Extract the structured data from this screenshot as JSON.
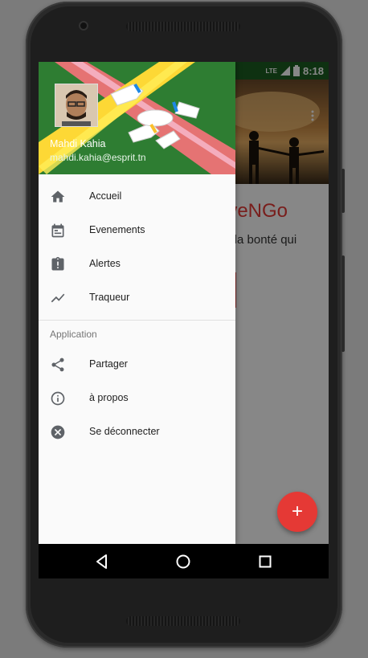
{
  "status_bar": {
    "network": "LTE",
    "time": "8:18"
  },
  "app": {
    "title_fragment": "iveNGo",
    "subtitle_fragment": "z la bonté qui",
    "fab_label": "+"
  },
  "drawer": {
    "user": {
      "name": "Mahdi Kahia",
      "email": "mahdi.kahia@esprit.tn"
    },
    "items": [
      {
        "label": "Accueil",
        "icon": "home-icon"
      },
      {
        "label": "Evenements",
        "icon": "calendar-icon"
      },
      {
        "label": "Alertes",
        "icon": "alert-clipboard-icon"
      },
      {
        "label": "Traqueur",
        "icon": "trending-icon"
      }
    ],
    "section_title": "Application",
    "section_items": [
      {
        "label": "Partager",
        "icon": "share-icon"
      },
      {
        "label": "à propos",
        "icon": "info-icon"
      },
      {
        "label": "Se déconnecter",
        "icon": "close-circle-icon"
      }
    ]
  },
  "colors": {
    "header_green": "#2e7d32",
    "accent_red": "#e53935",
    "icon_gray": "#5f6368"
  }
}
